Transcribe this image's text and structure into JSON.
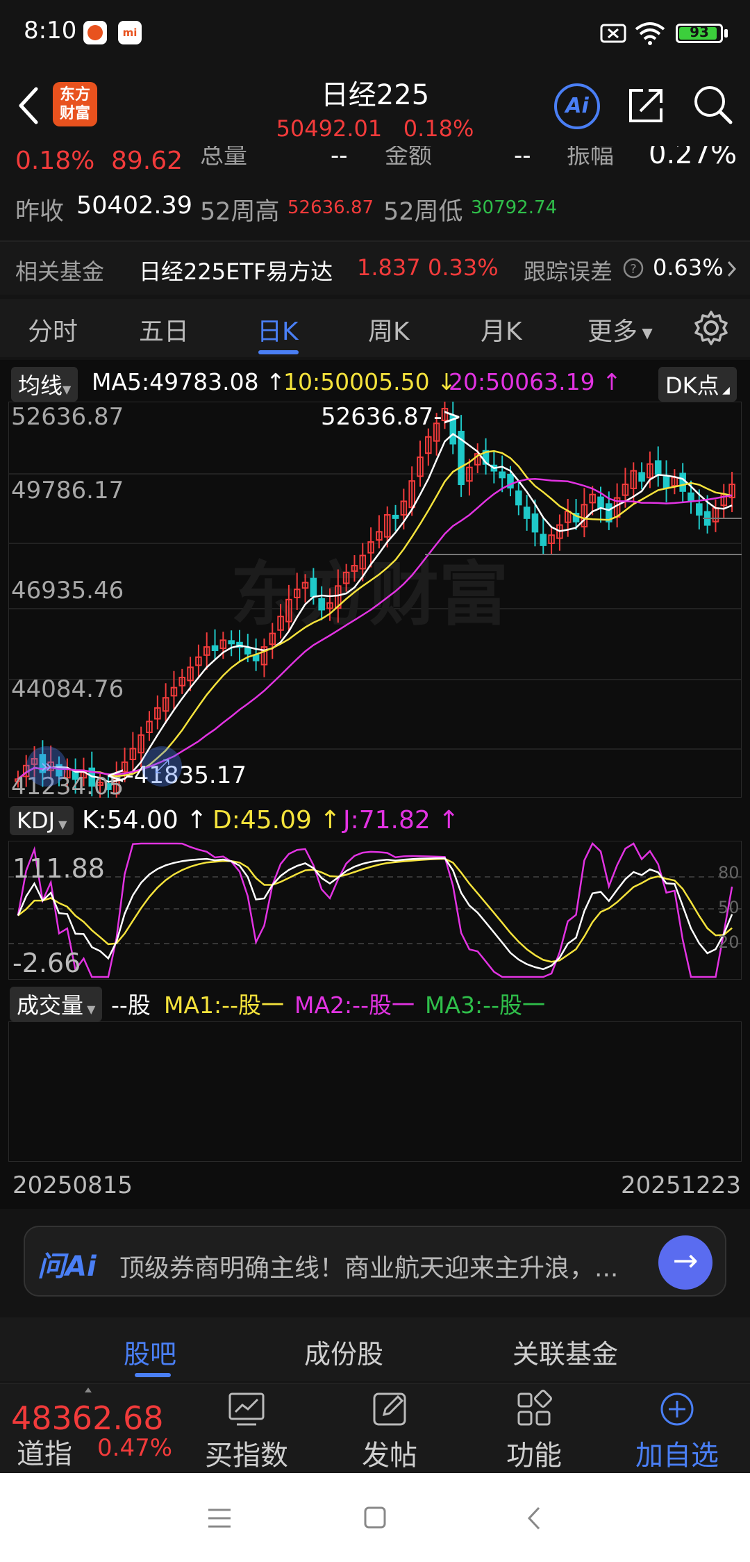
{
  "status_bar": {
    "time": "8:10",
    "battery": "93",
    "battery_level": 0.93
  },
  "header": {
    "title": "日经225",
    "price": "50492.01",
    "change_pct": "0.18%",
    "logo_text_1": "东方",
    "logo_text_2": "财富",
    "ai_label": "Ai"
  },
  "stats_row1": {
    "change_pct": "0.18%",
    "change": "89.62",
    "volume_label": "总量",
    "volume_value": "--",
    "amount_label": "金额",
    "amount_value": "--",
    "amplitude_label": "振幅",
    "amplitude_value": "0.27%"
  },
  "stats_row2": {
    "prev_close_label": "昨收",
    "prev_close": "50402.39",
    "high52_label": "52周高",
    "high52": "52636.87",
    "low52_label": "52周低",
    "low52": "30792.74"
  },
  "fund_row": {
    "label": "相关基金",
    "fund_name": "日经225ETF易方达",
    "fund_price": "1.837",
    "fund_change": "0.33%",
    "tracking_label": "跟踪误差",
    "tracking_value": "0.63%"
  },
  "tabs": [
    "分时",
    "五日",
    "日K",
    "周K",
    "月K",
    "更多"
  ],
  "active_tab": "日K",
  "ma_legend": {
    "selector": "均线",
    "ma5": "MA5:49783.08",
    "ma10": "10:50005.50",
    "ma20": "20:50063.19",
    "dk": "DK点"
  },
  "kdj_legend": {
    "selector": "KDJ",
    "k": "K:54.00",
    "d": "D:45.09",
    "j": "J:71.82"
  },
  "vol_legend": {
    "selector": "成交量",
    "vol": "--股",
    "ma1": "MA1:--股一",
    "ma2": "MA2:--股一",
    "ma3": "MA3:--股一"
  },
  "dates": {
    "start": "20250815",
    "end": "20251223"
  },
  "chart_data": {
    "type": "candlestick",
    "y_ticks": [
      "52636.87",
      "49786.17",
      "46935.46",
      "44084.76",
      "41234.05"
    ],
    "ylim": [
      41234.05,
      52636.87
    ],
    "annotations": {
      "high": "52636.87->",
      "low": "<-41835.17"
    },
    "kdj_ticks": {
      "top": "111.88",
      "bottom": "-2.66",
      "r80": "80",
      "r50": "50",
      "r20": "20"
    },
    "x": [
      "20250815",
      "20251223"
    ],
    "series": [
      {
        "name": "MA5",
        "color": "#ffffff"
      },
      {
        "name": "MA10",
        "color": "#f5e33c"
      },
      {
        "name": "MA20",
        "color": "#e233e2"
      }
    ]
  },
  "ask_ai": {
    "logo": "问Ai",
    "text": "顶级券商明确主线！商业航天迎来主升浪，..."
  },
  "sub_tabs": [
    "股吧",
    "成份股",
    "关联基金"
  ],
  "bottom": {
    "index_value": "48362.68",
    "index_name": "道指",
    "index_change": "0.47%",
    "buy": "买指数",
    "post": "发帖",
    "func": "功能",
    "add": "加自选"
  }
}
